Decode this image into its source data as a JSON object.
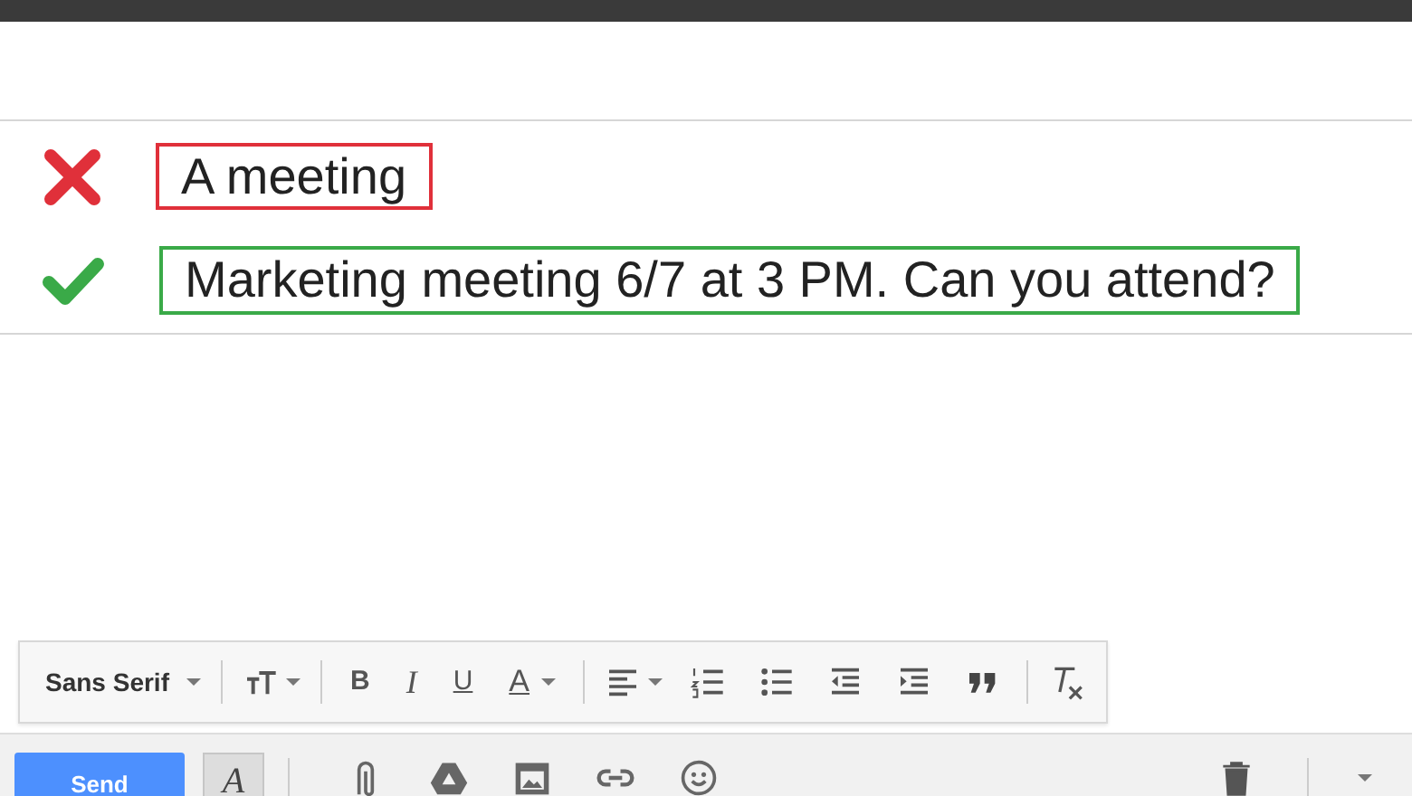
{
  "subject_examples": [
    {
      "kind": "bad",
      "text": "A meeting"
    },
    {
      "kind": "good",
      "text": "Marketing meeting 6/7 at 3 PM. Can you attend?"
    }
  ],
  "format_toolbar": {
    "font": "Sans Serif",
    "bold": "B",
    "italic": "I",
    "underline": "U",
    "text_color": "A"
  },
  "compose_bar": {
    "send": "Send",
    "formatting": "A",
    "formatting_selected": true
  }
}
